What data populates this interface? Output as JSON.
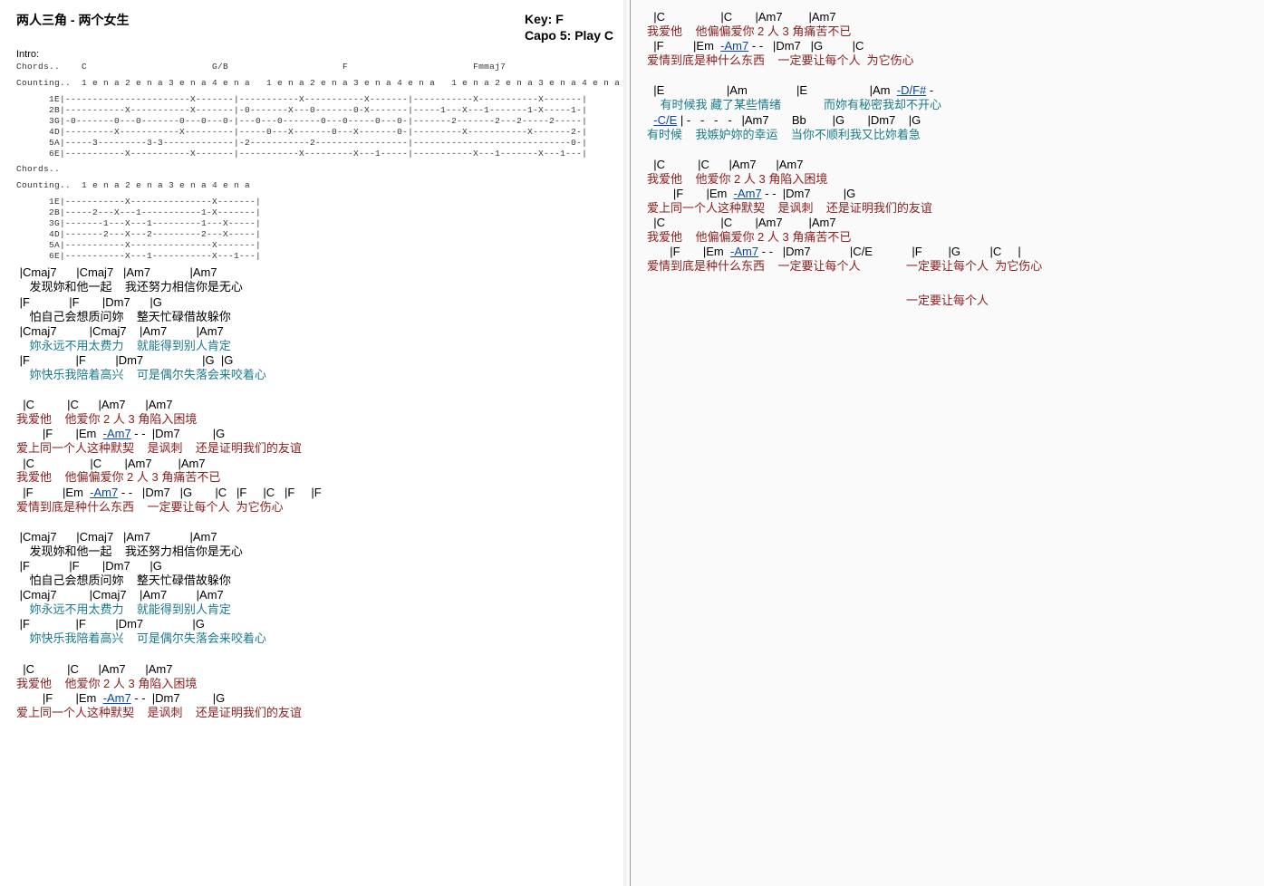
{
  "header": {
    "title": "两人三角 - 两个女生",
    "key": "Key: F",
    "capo": "Capo 5: Play C"
  },
  "labels": {
    "intro": "Intro:",
    "chords": "Chords..",
    "counting": "Counting.."
  },
  "intro": {
    "chordRow": "Chords..    C                       G/B                     F                       Fmmaj7",
    "countRow": "Counting..  1 e n a 2 e n a 3 e n a 4 e n a   1 e n a 2 e n a 3 e n a 4 e n a   1 e n a 2 e n a 3 e n a 4 e n a",
    "tab": "      1E|-----------------------X-------|-----------X-----------X-------|-----------X-----------X-------|\n      2B|-----------X-----------X-------|-0-------X---0-------0-X-------|-----1---X---1-------1-X-----1-|\n      3G|-0-------0---0-------0---0---0-|---0---0-------0---0-----0---0-|-------2-------2---2-----2-----|\n      4D|---------X-----------X---------|-----0---X-------0---X-------0-|---------X-----------X-------2-|\n      5A|-----3---------3-3-------------|-2-----------2-----------------|-----------------------------0-|\n      6E|-----------X-----------X-------|-----------X---------X---1-----|-----------X---1-------X---1---|"
  },
  "intro2": {
    "chordRow": "Chords..",
    "countRow": "Counting..  1 e n a 2 e n a 3 e n a 4 e n a",
    "tab": "      1E|-----------X---------------X-------|\n      2B|-----2---X---1-----------1-X-------|\n      3G|-------1---X---1---------1---X-----|\n      4D|-------2---X---2---------2---X-----|\n      5A|-----------X---------------X-------|\n      6E|-----------X---1-----------X---1---|"
  },
  "verse1": [
    {
      "chords": " |Cmaj7      |Cmaj7   |Am7            |Am7",
      "lyric": "    发现妳和他一起    我还努力相信你是无心",
      "color": "black"
    },
    {
      "chords": " |F            |F       |Dm7      |G",
      "lyric": "    怕自己会想质问妳    整天忙碌借故躲你",
      "color": "black"
    },
    {
      "chords": " |Cmaj7          |Cmaj7    |Am7         |Am7",
      "lyric": "    妳永远不用太费力    就能得到别人肯定",
      "color": "teal"
    },
    {
      "chords": " |F              |F         |Dm7                  |G  |G",
      "lyric": "    妳快乐我陪着高兴    可是偶尔失落会来咬着心",
      "color": "teal"
    }
  ],
  "chorus1": [
    {
      "chords": "  |C          |C      |Am7      |Am7",
      "lyric": "我爱他    他爱你 2 人 3 角陷入困境",
      "color": "red"
    },
    {
      "chordsPrefix": "        |F       |Em  ",
      "chordsLink": "-Am7",
      "chordsSuffix": " - -  |Dm7          |G",
      "lyric": "爱上同一个人这种默契    是讽刺    还是证明我们的友谊",
      "color": "red"
    },
    {
      "chords": "  |C                 |C       |Am7        |Am7",
      "lyric": "我爱他    他偏偏爱你 2 人 3 角痛苦不已",
      "color": "red"
    },
    {
      "chordsPrefix": "  |F         |Em  ",
      "chordsLink": "-Am7",
      "chordsSuffix": " - -   |Dm7   |G       |C   |F     |C   |F     |F",
      "lyric": "爱情到底是种什么东西    一定要让每个人  为它伤心",
      "color": "red"
    }
  ],
  "verse2": [
    {
      "chords": " |Cmaj7      |Cmaj7   |Am7            |Am7",
      "lyric": "    发现妳和他一起    我还努力相信你是无心",
      "color": "black"
    },
    {
      "chords": " |F            |F       |Dm7      |G",
      "lyric": "    怕自己会想质问妳    整天忙碌借故躲你",
      "color": "black"
    },
    {
      "chords": " |Cmaj7          |Cmaj7    |Am7         |Am7",
      "lyric": "    妳永远不用太费力    就能得到别人肯定",
      "color": "teal"
    },
    {
      "chords": " |F              |F         |Dm7               |G",
      "lyric": "    妳快乐我陪着高兴    可是偶尔失落会来咬着心",
      "color": "teal"
    }
  ],
  "chorus2": [
    {
      "chords": "  |C          |C      |Am7      |Am7",
      "lyric": "我爱他    他爱你 2 人 3 角陷入困境",
      "color": "red"
    },
    {
      "chordsPrefix": "        |F       |Em  ",
      "chordsLink": "-Am7",
      "chordsSuffix": " - -  |Dm7          |G",
      "lyric": "爱上同一个人这种默契    是讽刺    还是证明我们的友谊",
      "color": "red"
    }
  ],
  "rightTop": [
    {
      "chords": "  |C                 |C       |Am7        |Am7",
      "lyric": "我爱他    他偏偏爱你 2 人 3 角痛苦不已",
      "color": "red"
    },
    {
      "chordsPrefix": "  |F         |Em  ",
      "chordsLink": "-Am7",
      "chordsSuffix": " - -   |Dm7   |G         |C",
      "lyric": "爱情到底是种什么东西    一定要让每个人  为它伤心",
      "color": "red"
    }
  ],
  "bridge": [
    {
      "chordsPrefix": "  |E                   |Am               |E                   |Am  ",
      "chordsLink": "-D/F#",
      "chordsSuffix": " -",
      "lyric": "    有时候我 藏了某些情绪             而妳有秘密我却不开心",
      "color": "teal"
    },
    {
      "chordsPrefix": "  ",
      "chordsLink": "-C/E",
      "chordsSuffix": " | -   -   -   -   |Am7       Bb        |G       |Dm7    |G",
      "lyric": "有时候    我嫉妒妳的幸运    当你不顺利我又比妳着急",
      "color": "teal"
    }
  ],
  "chorus3": [
    {
      "chords": "  |C          |C      |Am7      |Am7",
      "lyric": "我爱他    他爱你 2 人 3 角陷入困境",
      "color": "red"
    },
    {
      "chordsPrefix": "        |F       |Em  ",
      "chordsLink": "-Am7",
      "chordsSuffix": " - -  |Dm7          |G",
      "lyric": "爱上同一个人这种默契    是讽刺    还是证明我们的友谊",
      "color": "red"
    },
    {
      "chords": "  |C                 |C       |Am7        |Am7",
      "lyric": "我爱他    他偏偏爱你 2 人 3 角痛苦不已",
      "color": "red"
    },
    {
      "chordsPrefix": "       |F       |Em  ",
      "chordsLink": "-Am7",
      "chordsSuffix": " - -   |Dm7            |C/E            |F        |G         |C     |",
      "lyric": "爱情到底是种什么东西    一定要让每个人              一定要让每个人  为它伤心",
      "color": "red"
    }
  ],
  "outro": "一定要让每个人"
}
